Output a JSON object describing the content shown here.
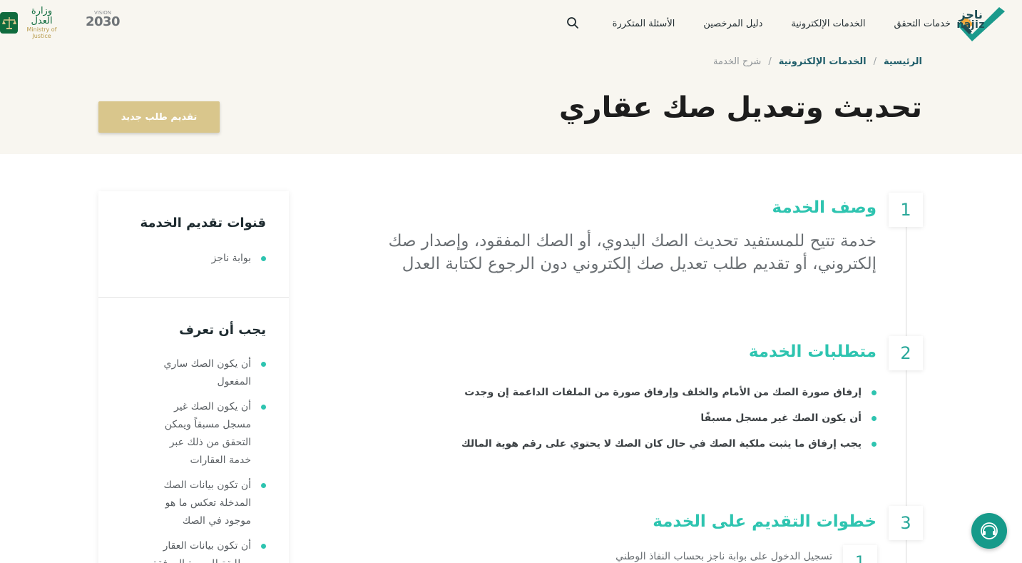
{
  "header": {
    "logo": {
      "ar": "ناجز",
      "en": "najiz"
    },
    "nav": [
      {
        "label": "خدمات التحقق"
      },
      {
        "label": "الخدمات الإلكترونية"
      },
      {
        "label": "دليل المرخصين"
      },
      {
        "label": "الأسئلة المتكررة"
      }
    ],
    "search_icon": "search-icon",
    "vision_logo": {
      "top": "VISION",
      "big": "2030"
    },
    "moj_logo": {
      "ar": "وزارة العدل",
      "en": "Ministry of Justice"
    }
  },
  "breadcrumb": {
    "home": "الرئيسية",
    "section": "الخدمات الإلكترونية",
    "current": "شرح الخدمة",
    "separator": "/"
  },
  "page": {
    "title": "تحديث وتعديل صك عقاري",
    "new_request_label": "تقديم طلب جديد"
  },
  "steps": [
    {
      "number": "1",
      "title": "وصف الخدمة",
      "description": "خدمة تتيح للمستفيد تحديث الصك اليدوي، أو الصك المفقود، وإصدار صك إلكتروني، أو تقديم طلب تعديل صك إلكتروني دون الرجوع لكتابة العدل"
    },
    {
      "number": "2",
      "title": "متطلبات الخدمة",
      "items": [
        "إرفاق صورة الصك من الأمام والخلف وإرفاق صورة من الملفات الداعمة إن وجدت",
        "أن يكون الصك غير مسجل مسبقًا",
        "يجب إرفاق ما يثبت ملكية الصك في حال كان الصك لا يحتوي على رقم هوية المالك"
      ]
    },
    {
      "number": "3",
      "title": "خطوات التقديم على الخدمة",
      "sub_steps": [
        {
          "number": "1",
          "text": "تسجيل الدخول على بوابة ناجز بحساب النفاذ الوطني"
        }
      ]
    }
  ],
  "sidebar": {
    "channels_title": "قنوات تقديم الخدمة",
    "channels": [
      "بوابة ناجز"
    ],
    "know_title": "يجب أن تعرف",
    "know_items": [
      "أن يكون الصك ساري المفعول",
      "أن يكون الصك غير مسجل مسبقاً ويمكن التحقق من ذلك عبر خدمة العقارات",
      "أن تكون بيانات الصك المدخلة تعكس ما هو موجود في الصك",
      "أن تكون بيانات العقار مطابقة للصورة المرفقة"
    ]
  },
  "colors": {
    "accent": "#2ec4b0",
    "brand_dark": "#1f5d6a",
    "gold": "#d9c68c",
    "hero_bg": "#f8f6f0",
    "fab": "#169a8a"
  }
}
